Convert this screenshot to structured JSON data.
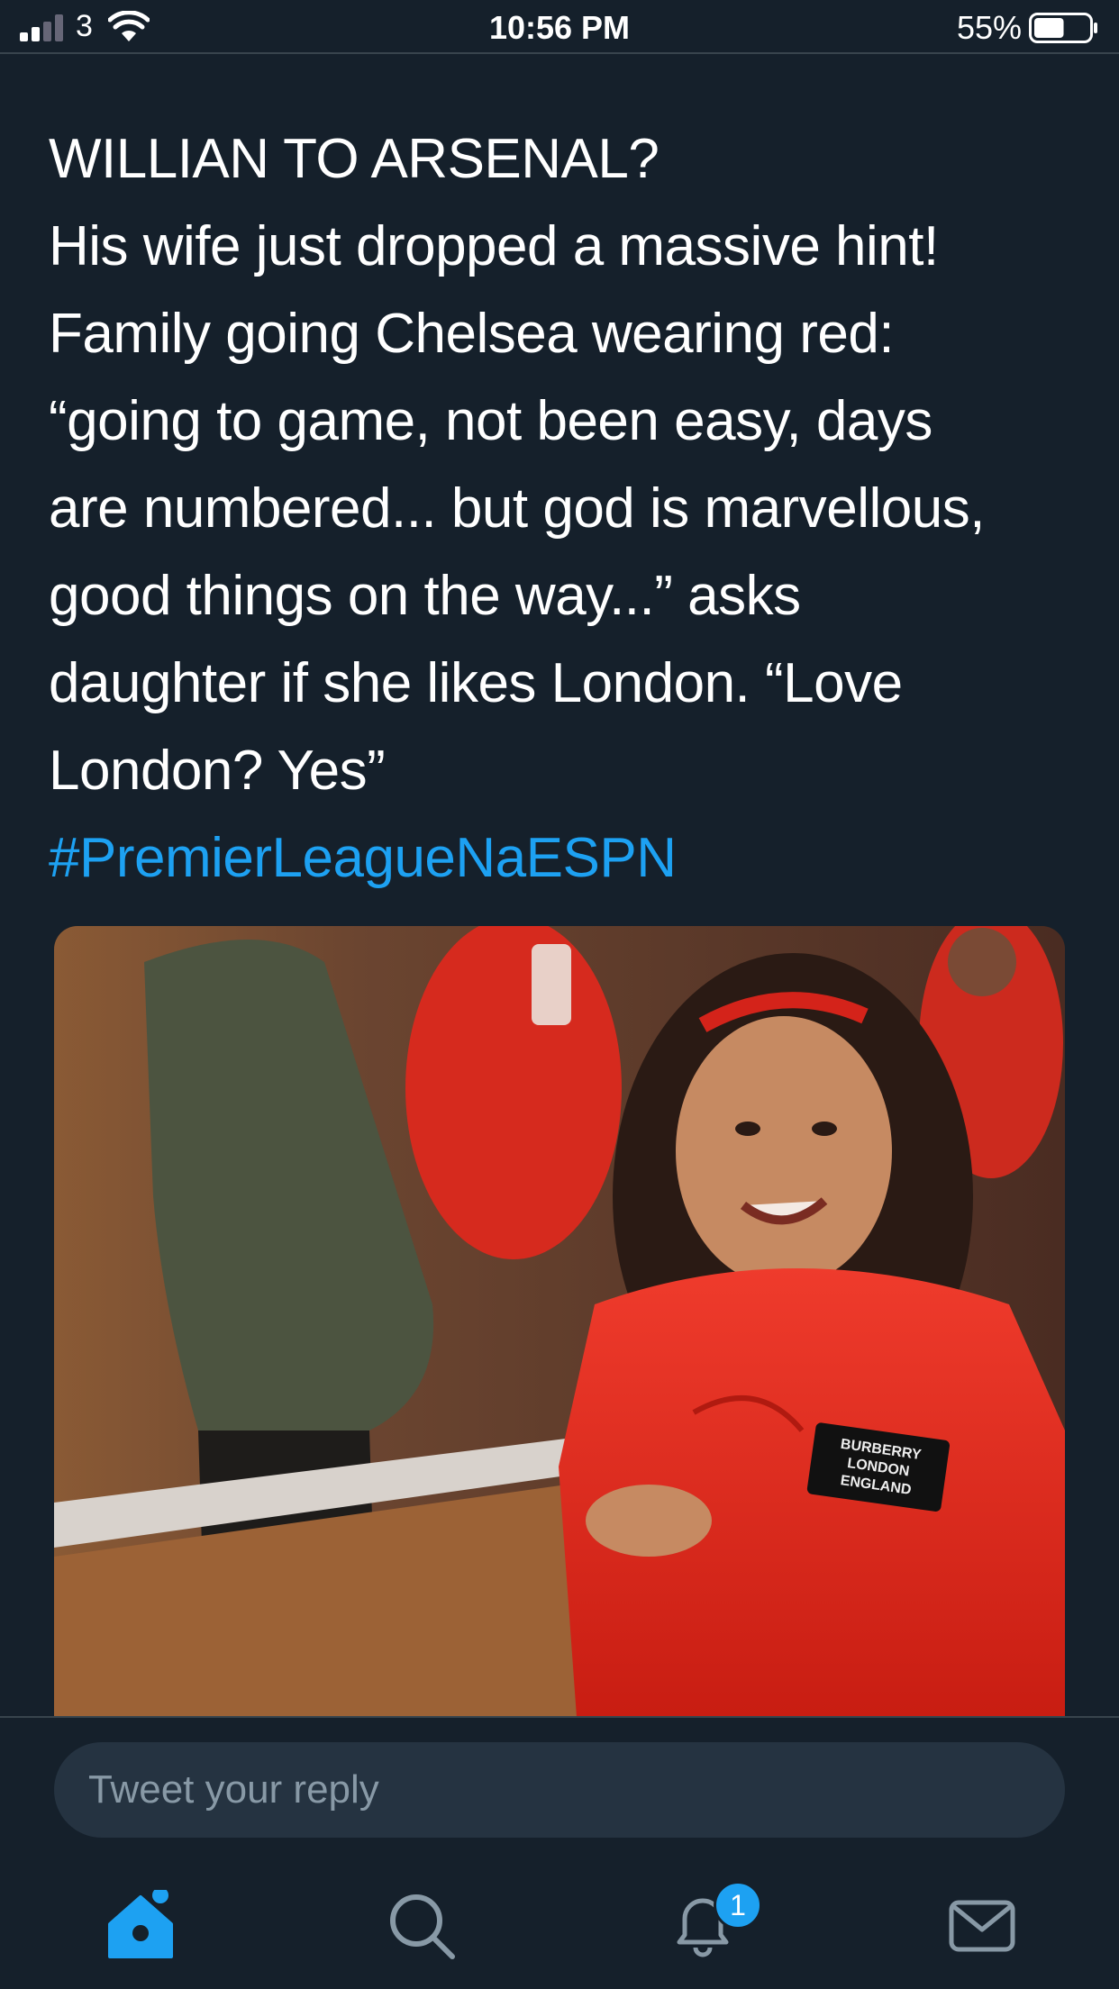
{
  "status_bar": {
    "carrier": "3",
    "time": "10:56 PM",
    "battery_percent": "55%",
    "battery_level": 0.55,
    "signal_bars": 2,
    "signal_bars_total": 4
  },
  "tweet": {
    "lines": [
      "WILLIAN TO ARSENAL?",
      "His wife just dropped a massive hint!",
      "Family going Chelsea wearing red:",
      "“going to game, not been easy, days",
      "are numbered... but god is marvellous,",
      "good things on the way...” asks",
      "daughter if she likes London. “Love",
      "London? Yes”"
    ],
    "hashtag": "#PremierLeagueNaESPN",
    "media_patch_text": [
      "BURBERRY",
      "LONDON",
      "ENGLAND"
    ]
  },
  "reply": {
    "placeholder": "Tweet your reply"
  },
  "tab_bar": {
    "tabs": [
      "home-icon",
      "search-icon",
      "notifications-icon",
      "messages-icon"
    ],
    "notification_count": "1"
  },
  "colors": {
    "background": "#15202b",
    "accent": "#1da1f2",
    "text": "#ffffff",
    "muted": "#8899a6",
    "input_bg": "#253341",
    "divider": "#38444d"
  }
}
